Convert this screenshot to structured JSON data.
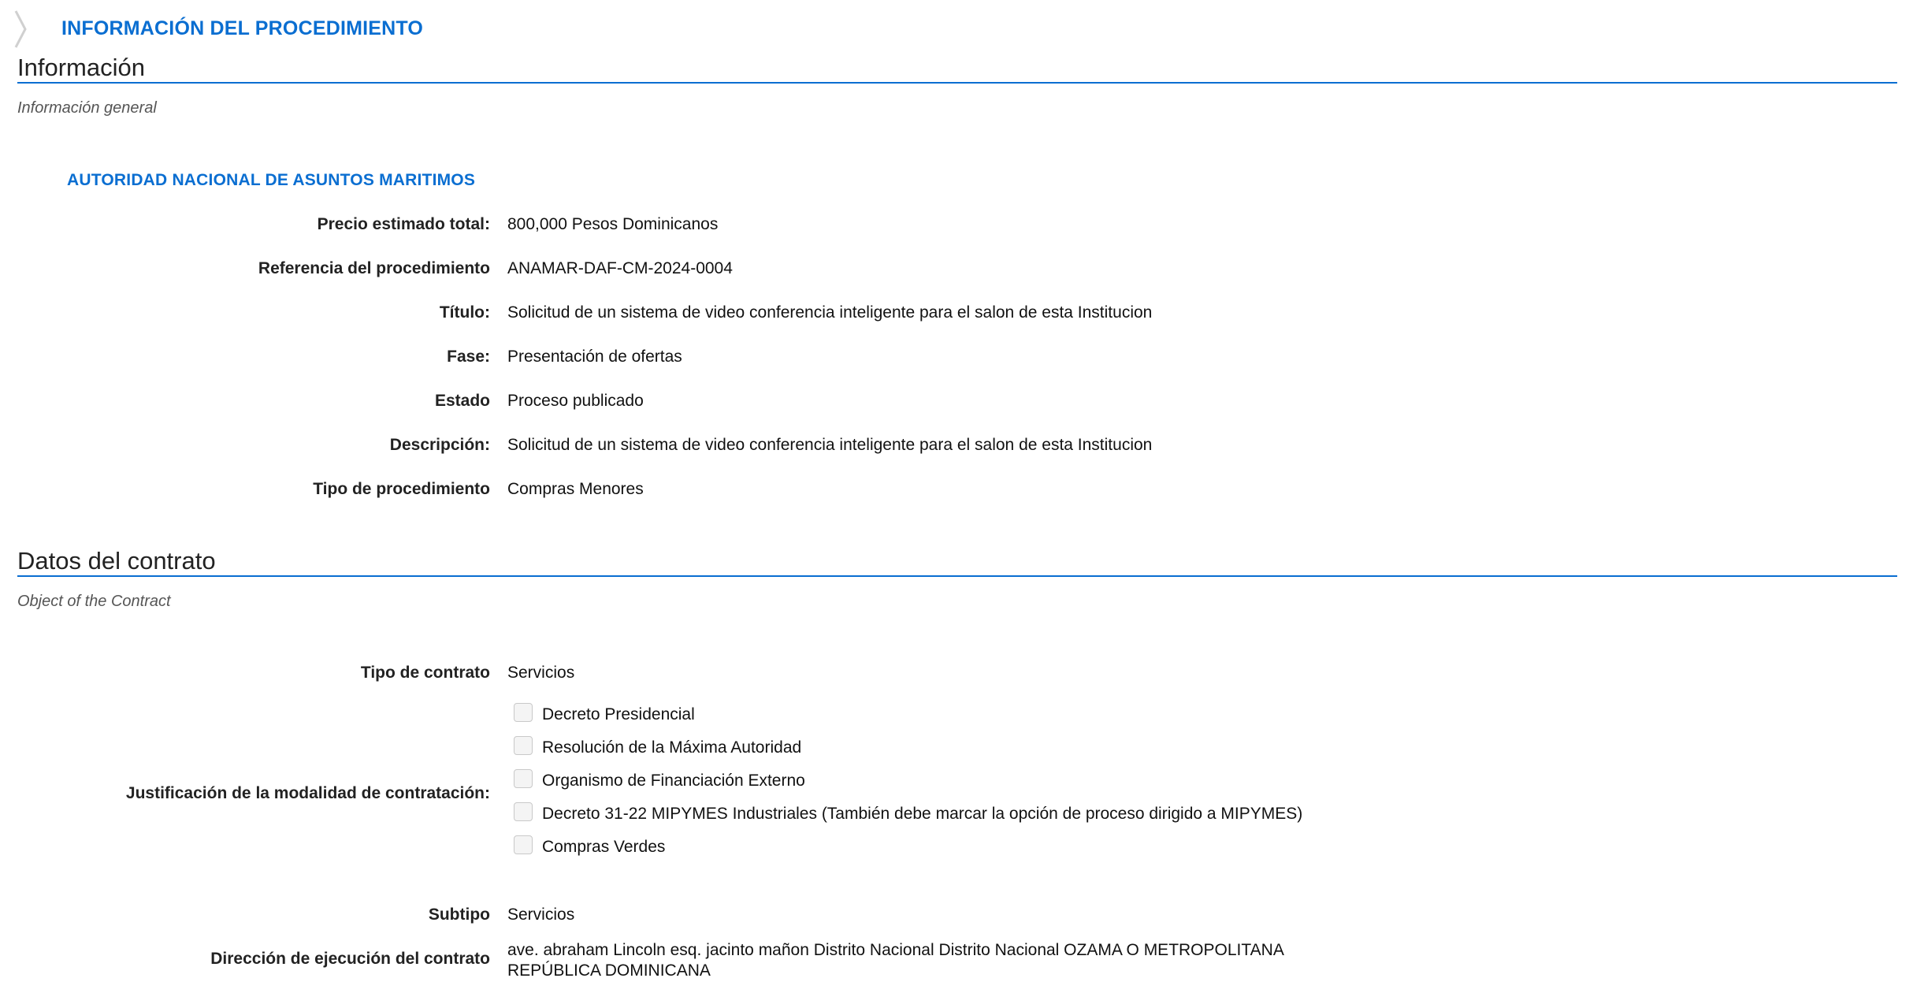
{
  "header": {
    "title": "INFORMACIÓN DEL PROCEDIMIENTO",
    "icon": "chevron-right-icon"
  },
  "info_section": {
    "heading": "Información",
    "subheading": "Información general",
    "organization": "AUTORIDAD NACIONAL DE ASUNTOS MARITIMOS",
    "fields": [
      {
        "label": "Precio estimado total:",
        "value": "800,000 Pesos Dominicanos"
      },
      {
        "label": "Referencia del procedimiento",
        "value": "ANAMAR-DAF-CM-2024-0004"
      },
      {
        "label": "Título:",
        "value": "Solicitud de un sistema de video conferencia inteligente para el salon de esta Institucion"
      },
      {
        "label": "Fase:",
        "value": "Presentación de ofertas"
      },
      {
        "label": "Estado",
        "value": "Proceso publicado"
      },
      {
        "label": "Descripción:",
        "value": "Solicitud de un sistema de video conferencia inteligente para el salon de esta Institucion"
      },
      {
        "label": "Tipo de procedimiento",
        "value": "Compras Menores"
      }
    ]
  },
  "contract_section": {
    "heading": "Datos del contrato",
    "subheading": "Object of the Contract",
    "contract_type": {
      "label": "Tipo de contrato",
      "value": "Servicios"
    },
    "justification": {
      "label": "Justificación de la modalidad de contratación:",
      "options": [
        {
          "label": "Decreto Presidencial",
          "checked": false
        },
        {
          "label": "Resolución de la Máxima Autoridad",
          "checked": false
        },
        {
          "label": "Organismo de Financiación Externo",
          "checked": false
        },
        {
          "label": "Decreto 31-22 MIPYMES Industriales (También debe marcar la opción de proceso dirigido a MIPYMES)",
          "checked": false
        },
        {
          "label": "Compras Verdes",
          "checked": false
        }
      ]
    },
    "subtype": {
      "label": "Subtipo",
      "value": "Servicios"
    },
    "address": {
      "label": "Dirección de ejecución del contrato",
      "line1": "ave. abraham Lincoln esq. jacinto mañon Distrito Nacional Distrito Nacional OZAMA O METROPOLITANA",
      "line2": "REPÚBLICA DOMINICANA"
    }
  },
  "colors": {
    "accent": "#0a6ed1",
    "text": "#222222",
    "muted": "#555555"
  }
}
